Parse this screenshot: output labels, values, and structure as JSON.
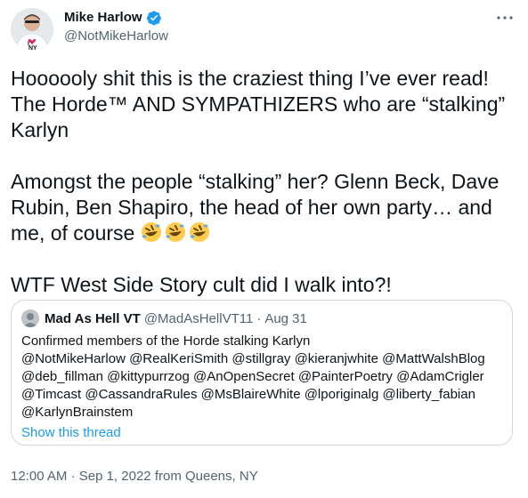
{
  "author": {
    "display_name": "Mike Harlow",
    "handle": "@NotMikeHarlow",
    "verified": true,
    "avatar_shirt_text": "I NY"
  },
  "tweet": {
    "paragraphs": [
      "Hoooooly shit this is the craziest thing I’ve ever read! The Horde™ AND SYMPATHIZERS who are “stalking” Karlyn",
      "Amongst the people “stalking” her? Glenn Beck, Dave Rubin, Ben Shapiro, the head of her own party… and me, of course",
      "WTF West Side Story cult did I walk into?!"
    ],
    "emoji": [
      "rolling-on-floor-laughing",
      "rolling-on-floor-laughing",
      "rolling-on-floor-laughing"
    ]
  },
  "quote": {
    "display_name": "Mad As Hell VT",
    "handle": "@MadAsHellVT11",
    "separator": "·",
    "date": "Aug 31",
    "lines": [
      "Confirmed members of the Horde stalking Karlyn",
      "@NotMikeHarlow @RealKeriSmith @stillgray @kieranjwhite @MattWalshBlog",
      "@deb_fillman @kittypurrzog @AnOpenSecret @PainterPoetry @AdamCrigler",
      "@Timcast @CassandraRules @MsBlaireWhite @lporiginalg @liberty_fabian",
      "@KarlynBrainstem"
    ],
    "show_thread": "Show this thread"
  },
  "meta": {
    "time": "12:00 AM",
    "separator": "·",
    "date": "Sep 1, 2022",
    "source_prefix": "from",
    "location": "Queens, NY"
  },
  "colors": {
    "text": "#0f1419",
    "secondary": "#536471",
    "link": "#1d9bf0",
    "verified": "#1d9bf0",
    "border": "#cfd9de"
  },
  "icons": {
    "verified": "verified-badge-icon",
    "more": "more-dots-icon"
  }
}
